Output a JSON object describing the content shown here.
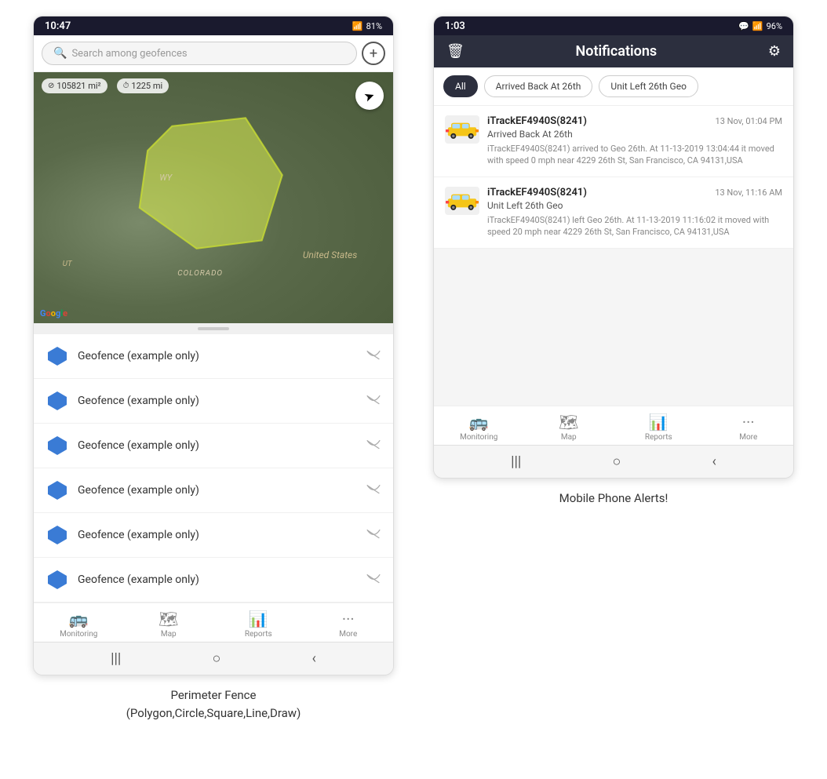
{
  "left_phone": {
    "status_time": "10:47",
    "status_battery": "81%",
    "status_signal": "WiFi+4G",
    "search_placeholder": "Search among geofences",
    "add_button_label": "+",
    "map_stats": {
      "area": "105821 mi²",
      "distance": "1225 mi"
    },
    "map_labels": {
      "state_wy": "WY",
      "country": "United States",
      "state_colorado": "COLORADO",
      "state_ut": "UT"
    },
    "geofence_items": [
      {
        "label": "Geofence (example only)"
      },
      {
        "label": "Geofence (example only)"
      },
      {
        "label": "Geofence (example only)"
      },
      {
        "label": "Geofence (example only)"
      },
      {
        "label": "Geofence (example only)"
      },
      {
        "label": "Geofence (example only)"
      }
    ],
    "bottom_nav": [
      {
        "icon": "🚌",
        "label": "Monitoring"
      },
      {
        "icon": "🗺",
        "label": "Map"
      },
      {
        "icon": "📊",
        "label": "Reports"
      },
      {
        "icon": "···",
        "label": "More"
      }
    ],
    "caption": "Perimeter Fence\n(Polygon,Circle,Square,Line,Draw)"
  },
  "right_phone": {
    "status_time": "1:03",
    "status_battery": "96%",
    "header_title": "Notifications",
    "filter_tabs": [
      {
        "label": "All",
        "active": true
      },
      {
        "label": "Arrived Back At 26th",
        "active": false
      },
      {
        "label": "Unit Left 26th Geo",
        "active": false
      }
    ],
    "notifications": [
      {
        "device": "iTrackEF4940S(8241)",
        "time": "13 Nov, 01:04 PM",
        "event": "Arrived Back At 26th",
        "description": "iTrackEF4940S(8241) arrived to Geo 26th.    At 11-13-2019 13:04:44 it moved with speed 0 mph near 4229 26th St, San Francisco, CA 94131,USA"
      },
      {
        "device": "iTrackEF4940S(8241)",
        "time": "13 Nov, 11:16 AM",
        "event": "Unit Left 26th Geo",
        "description": "iTrackEF4940S(8241) left Geo 26th.   At 11-13-2019 11:16:02 it moved with speed 20 mph near 4229 26th St, San Francisco, CA 94131,USA"
      }
    ],
    "bottom_nav": [
      {
        "icon": "🚌",
        "label": "Monitoring"
      },
      {
        "icon": "🗺",
        "label": "Map"
      },
      {
        "icon": "📊",
        "label": "Reports"
      },
      {
        "icon": "···",
        "label": "More"
      }
    ],
    "caption": "Mobile Phone Alerts!"
  }
}
